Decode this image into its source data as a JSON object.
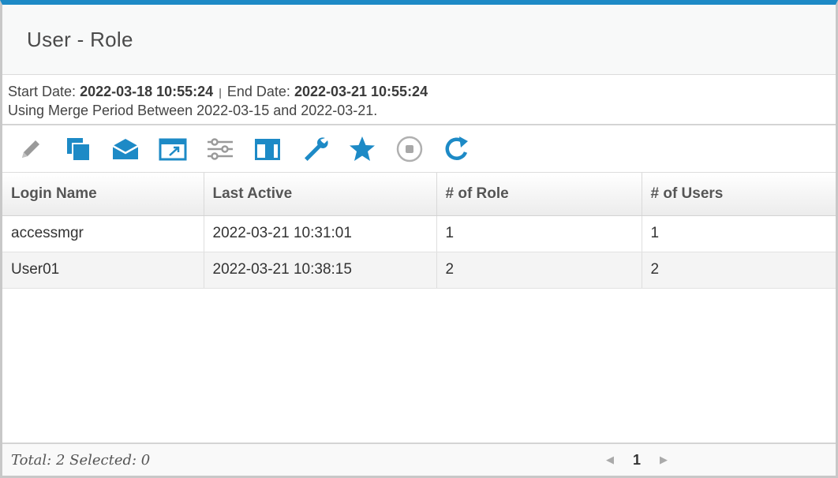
{
  "window": {
    "title": "User - Role"
  },
  "info": {
    "start_label": "Start Date:",
    "start_value": "2022-03-18 10:55:24",
    "separator": "|",
    "end_label": "End Date:",
    "end_value": "2022-03-21 10:55:24",
    "merge_text": "Using Merge Period Between 2022-03-15 and 2022-03-21."
  },
  "toolbar": {
    "icons": [
      "pencil-icon",
      "copy-icon",
      "mail-icon",
      "open-window-icon",
      "sliders-icon",
      "columns-icon",
      "wrench-icon",
      "star-icon",
      "stop-icon",
      "refresh-icon"
    ],
    "accent": "#1d8ac6",
    "disabled": "#9a9a9a"
  },
  "table": {
    "columns": [
      "Login Name",
      "Last Active",
      "# of Role",
      "# of Users"
    ],
    "rows": [
      [
        "accessmgr",
        "2022-03-21 10:31:01",
        "1",
        "1"
      ],
      [
        "User01",
        "2022-03-21 10:38:15",
        "2",
        "2"
      ]
    ]
  },
  "footer": {
    "summary": "Total: 2 Selected: 0",
    "page": "1"
  }
}
